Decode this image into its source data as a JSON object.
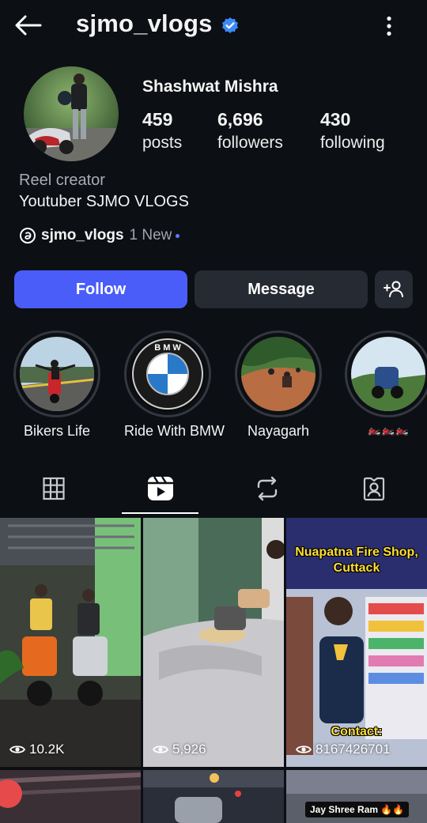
{
  "header": {
    "username": "sjmo_vlogs",
    "back_icon": "arrow-left-icon",
    "verified_icon": "verified-badge-icon",
    "more_icon": "more-vertical-icon"
  },
  "profile": {
    "full_name": "Shashwat Mishra",
    "stats": [
      {
        "value": "459",
        "label": "posts"
      },
      {
        "value": "6,696",
        "label": "followers"
      },
      {
        "value": "430",
        "label": "following"
      }
    ],
    "category": "Reel creator",
    "bio": "Youtuber SJMO VLOGS",
    "threads": {
      "handle": "sjmo_vlogs",
      "badge": "1 New"
    }
  },
  "actions": {
    "follow_label": "Follow",
    "message_label": "Message",
    "add_user_icon": "add-person-icon"
  },
  "highlights": [
    {
      "label": "Bikers Life"
    },
    {
      "label": "Ride With BMW",
      "logo_text": "B M W"
    },
    {
      "label": "Nayagarh"
    },
    {
      "label": "🏍️🏍️🏍️"
    }
  ],
  "tabs": [
    {
      "icon": "grid-icon"
    },
    {
      "icon": "reels-icon",
      "active": true
    },
    {
      "icon": "repost-icon"
    },
    {
      "icon": "tagged-icon"
    }
  ],
  "grid": {
    "items": [
      {
        "views": "10.2K"
      },
      {
        "views": "5,926"
      },
      {
        "views": "8167426701",
        "title": "Nuapatna Fire Shop, Cuttack",
        "contact": "Contact:"
      },
      {},
      {},
      {
        "caption": "Jay Shree Ram 🔥🔥"
      }
    ]
  },
  "colors": {
    "background": "#0c0f14",
    "follow_button": "#4a5df9",
    "secondary_button": "#262a33",
    "verified": "#3d8af7"
  }
}
